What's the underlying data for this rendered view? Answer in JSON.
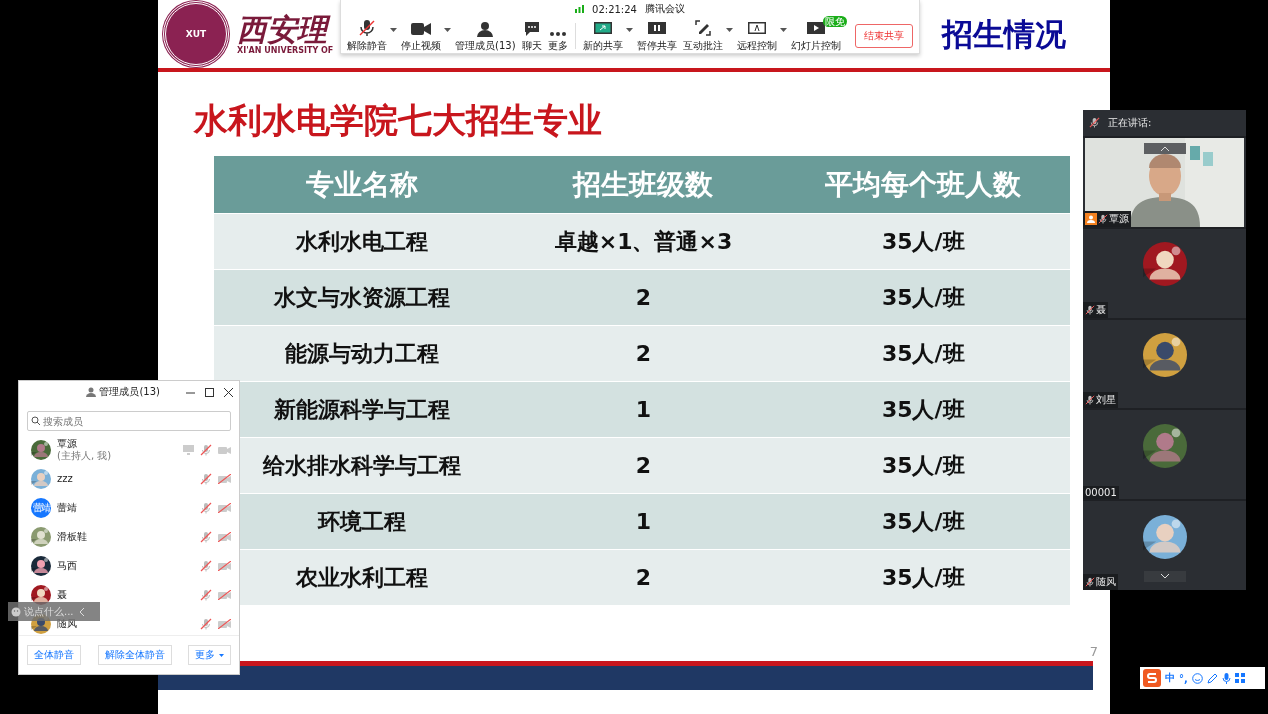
{
  "slide": {
    "logo": {
      "seal_text": "XUT",
      "name_cn": "西安理",
      "name_en": "XI'AN UNIVERSITY OF"
    },
    "section": "招生情况",
    "title": "水利水电学院七大招生专业",
    "table": {
      "columns": [
        "专业名称",
        "招生班级数",
        "平均每个班人数"
      ],
      "rows": [
        [
          "水利水电工程",
          "卓越×1、普通×3",
          "35人/班"
        ],
        [
          "水文与水资源工程",
          "2",
          "35人/班"
        ],
        [
          "能源与动力工程",
          "2",
          "35人/班"
        ],
        [
          "新能源科学与工程",
          "1",
          "35人/班"
        ],
        [
          "给水排水科学与工程",
          "2",
          "35人/班"
        ],
        [
          "环境工程",
          "1",
          "35人/班"
        ],
        [
          "农业水利工程",
          "2",
          "35人/班"
        ]
      ]
    },
    "page_number": "7"
  },
  "toolbar": {
    "time": "02:21:24",
    "app_name": "腾讯会议",
    "controls": [
      {
        "label": "解除静音",
        "caret": true
      },
      {
        "label": "停止视频",
        "caret": true
      },
      {
        "label": "管理成员(13)",
        "caret": false
      },
      {
        "label": "聊天",
        "caret": false
      },
      {
        "label": "更多",
        "caret": false
      }
    ],
    "share_controls": [
      {
        "label": "新的共享",
        "caret": true
      },
      {
        "label": "暂停共享",
        "caret": false
      },
      {
        "label": "互动批注",
        "caret": true
      },
      {
        "label": "远程控制",
        "caret": true
      },
      {
        "label": "幻灯片控制",
        "caret": false,
        "badge": "限免"
      }
    ],
    "end_button": "结束共享"
  },
  "members_window": {
    "title": "管理成员(13)",
    "search": {
      "placeholder": "搜索成员"
    },
    "members": [
      {
        "name": "覃源",
        "note": "(主持人, 我)",
        "kind": "picture",
        "sharing": true,
        "muted": true,
        "video_on": true
      },
      {
        "name": "zzz",
        "kind": "picture",
        "sharing": false,
        "muted": true,
        "video_on": false
      },
      {
        "name": "蕾靖",
        "kind": "initials",
        "avatar_text": "蕾靖",
        "sharing": false,
        "muted": true,
        "video_on": false
      },
      {
        "name": "滑板鞋",
        "kind": "picture",
        "sharing": false,
        "muted": true,
        "video_on": false
      },
      {
        "name": "马西",
        "kind": "picture",
        "sharing": false,
        "muted": true,
        "video_on": false
      },
      {
        "name": "聂",
        "kind": "picture",
        "sharing": false,
        "muted": true,
        "video_on": false
      },
      {
        "name": "随风",
        "kind": "picture",
        "sharing": false,
        "muted": true,
        "video_on": false
      }
    ],
    "buttons": [
      "全体静音",
      "解除全体静音",
      "更多"
    ],
    "chat_input": {
      "placeholder": "说点什么..."
    }
  },
  "video_panel": {
    "header": "正在讲话:",
    "tiles": [
      {
        "name": "覃源",
        "kind": "video",
        "host": true,
        "muted": true
      },
      {
        "name": "聂",
        "kind": "avatar",
        "host": false,
        "muted": true
      },
      {
        "name": "刘星",
        "kind": "avatar",
        "host": false,
        "muted": true
      },
      {
        "name": "00001",
        "kind": "avatar",
        "host": false,
        "muted": false
      },
      {
        "name": "随风",
        "kind": "avatar",
        "host": false,
        "muted": true
      }
    ]
  },
  "ime_bar": {
    "mode": "中",
    "punct": "°,"
  }
}
